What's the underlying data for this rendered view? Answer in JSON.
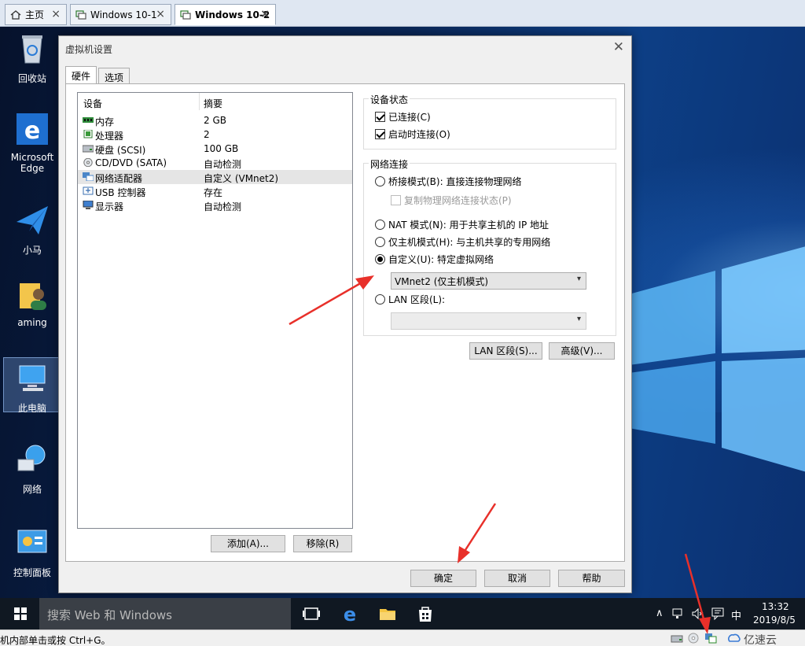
{
  "tabs": [
    {
      "label": "主页",
      "icon": "home-icon"
    },
    {
      "label": "Windows 10-1",
      "icon": "vm-icon"
    },
    {
      "label": "Windows 10-2",
      "icon": "vm-icon",
      "active": true
    }
  ],
  "desktop": {
    "icons": [
      {
        "label": "回收站",
        "icon": "recycle-bin-icon"
      },
      {
        "label": "Microsoft Edge",
        "icon": "edge-icon"
      },
      {
        "label": "小马",
        "icon": "paper-plane-icon"
      },
      {
        "label": "aming",
        "icon": "user-folder-icon"
      },
      {
        "label": "此电脑",
        "icon": "this-pc-icon"
      },
      {
        "label": "网络",
        "icon": "network-icon"
      },
      {
        "label": "控制面板",
        "icon": "control-panel-icon"
      }
    ]
  },
  "dialog": {
    "title": "虚拟机设置",
    "tabs": [
      "硬件",
      "选项"
    ],
    "device_list": {
      "headers": [
        "设备",
        "摘要"
      ],
      "rows": [
        {
          "name": "内存",
          "summary": "2 GB",
          "icon": "memory-icon"
        },
        {
          "name": "处理器",
          "summary": "2",
          "icon": "cpu-icon"
        },
        {
          "name": "硬盘 (SCSI)",
          "summary": "100 GB",
          "icon": "hard-disk-icon"
        },
        {
          "name": "CD/DVD (SATA)",
          "summary": "自动检测",
          "icon": "cd-icon"
        },
        {
          "name": "网络适配器",
          "summary": "自定义 (VMnet2)",
          "icon": "network-adapter-icon",
          "selected": true
        },
        {
          "name": "USB 控制器",
          "summary": "存在",
          "icon": "usb-icon"
        },
        {
          "name": "显示器",
          "summary": "自动检测",
          "icon": "monitor-icon"
        }
      ]
    },
    "add_button": "添加(A)...",
    "remove_button": "移除(R)",
    "device_status": {
      "label": "设备状态",
      "connected": "已连接(C)",
      "connect_at_power_on": "启动时连接(O)"
    },
    "network": {
      "label": "网络连接",
      "bridged": "桥接模式(B): 直接连接物理网络",
      "replicate": "复制物理网络连接状态(P)",
      "nat": "NAT 模式(N): 用于共享主机的 IP 地址",
      "host_only": "仅主机模式(H): 与主机共享的专用网络",
      "custom": "自定义(U): 特定虚拟网络",
      "custom_value": "VMnet2 (仅主机模式)",
      "lan": "LAN 区段(L):",
      "lan_value": ""
    },
    "lan_segments_button": "LAN 区段(S)...",
    "advanced_button": "高级(V)...",
    "ok_button": "确定",
    "cancel_button": "取消",
    "help_button": "帮助"
  },
  "taskbar": {
    "search_placeholder": "搜索 Web 和 Windows",
    "ime": "中",
    "time": "13:32",
    "date": "2019/8/5"
  },
  "statusbar": {
    "text": "机内部单击或按 Ctrl+G。",
    "watermark": "亿速云"
  },
  "colors": {
    "annotation_arrow": "#e8302a",
    "desktop_accent": "#0d3f86"
  }
}
